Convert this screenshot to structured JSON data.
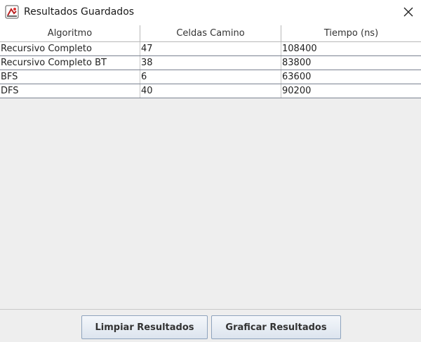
{
  "window": {
    "title": "Resultados Guardados",
    "app_icon": "java-icon",
    "close_icon": "close-icon"
  },
  "table": {
    "columns": [
      "Algoritmo",
      "Celdas Camino",
      "Tiempo (ns)"
    ],
    "rows": [
      [
        "Recursivo Completo",
        "47",
        "108400"
      ],
      [
        "Recursivo Completo BT",
        "38",
        "83800"
      ],
      [
        "BFS",
        "6",
        "63600"
      ],
      [
        "DFS",
        "40",
        "90200"
      ]
    ]
  },
  "buttons": {
    "clear_label": "Limpiar Resultados",
    "chart_label": "Graficar Resultados"
  }
}
